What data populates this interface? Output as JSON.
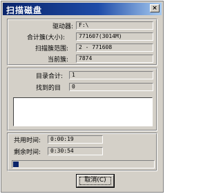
{
  "window": {
    "title": "扫描磁盘",
    "close_label": "×"
  },
  "info": {
    "drive_label": "驱动器:",
    "drive_value": "F:\\",
    "total_label": "合计簇(大小):",
    "total_value": "771607(3014M)",
    "range_label": "扫描簇范围:",
    "range_value": "2 - 771608",
    "current_label": "当前簇:",
    "current_value": "7874"
  },
  "results": {
    "dir_total_label": "目录合计:",
    "dir_total_value": "1",
    "found_label": "找到的目",
    "found_value": "0"
  },
  "time": {
    "elapsed_label": "共用时间:",
    "elapsed_value": "0:00:19",
    "remaining_label": "剩余时间:",
    "remaining_value": "0:30:54"
  },
  "progress": {
    "fraction": 0.04
  },
  "cancel_label": "取消(C)"
}
